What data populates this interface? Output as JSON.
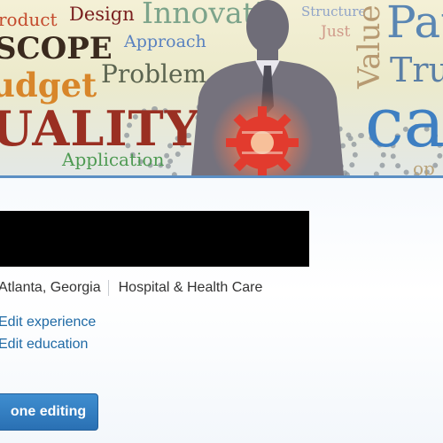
{
  "banner": {
    "words": {
      "product": "roduct",
      "design": "Design",
      "innovation": "Innovati",
      "structure": "Structure",
      "just": "Just",
      "pat": "Pat",
      "scope": "SCOPE",
      "approach": "Approach",
      "value": "Value",
      "trus": "Trus",
      "budget": "udget",
      "problem": "Problem",
      "quality": "UALITY",
      "ca": "ca",
      "application": "Application",
      "op": "op"
    },
    "accent_color": "#5b8fc4",
    "gear_color": "#e23b2e"
  },
  "profile": {
    "location": "Atlanta, Georgia",
    "industry": "Hospital & Health Care"
  },
  "links": {
    "edit_experience": "Edit experience",
    "edit_education": "Edit education"
  },
  "actions": {
    "done_editing": "one editing"
  }
}
